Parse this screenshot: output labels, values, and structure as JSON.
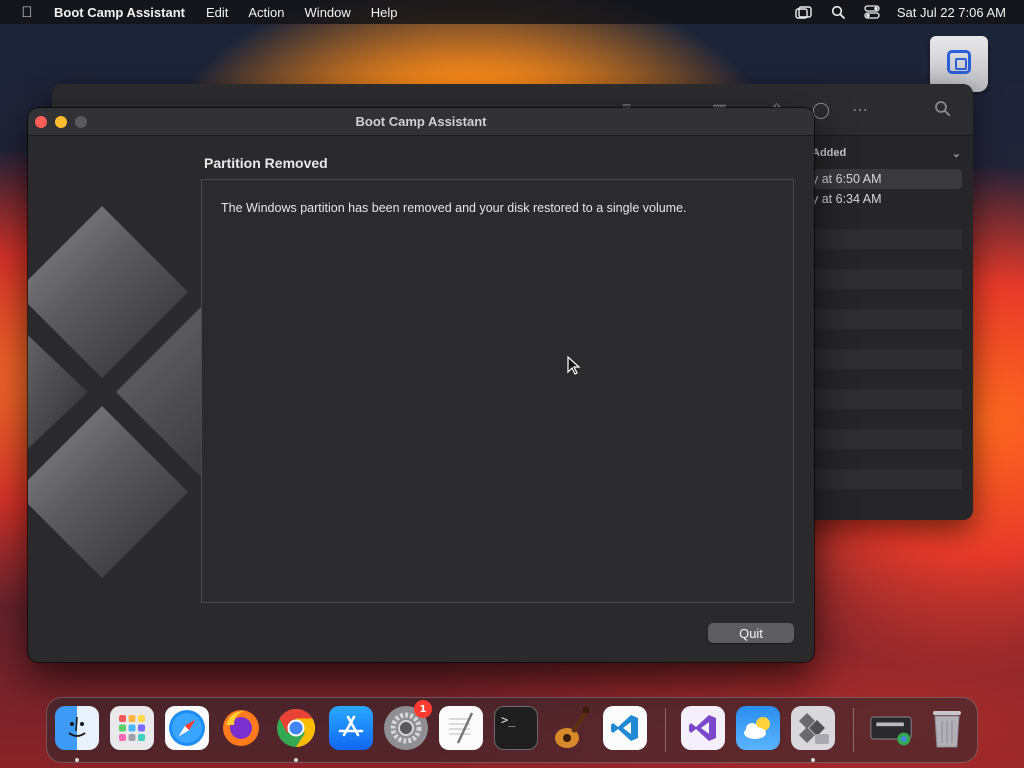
{
  "menubar": {
    "app_name": "Boot Camp Assistant",
    "menus": [
      "Edit",
      "Action",
      "Window",
      "Help"
    ],
    "clock": "Sat Jul 22  7:06 AM"
  },
  "finder": {
    "column_header": "Added",
    "rows": [
      "y at 6:50 AM",
      "y at 6:34 AM"
    ]
  },
  "window": {
    "title": "Boot Camp Assistant",
    "heading": "Partition Removed",
    "message": "The Windows partition has been removed and your disk restored to a single volume.",
    "quit_label": "Quit"
  },
  "dock": {
    "items": [
      {
        "name": "finder-icon",
        "running": true
      },
      {
        "name": "launchpad-icon",
        "running": false
      },
      {
        "name": "safari-icon",
        "running": false
      },
      {
        "name": "firefox-icon",
        "running": false
      },
      {
        "name": "chrome-icon",
        "running": true
      },
      {
        "name": "app-store-icon",
        "running": false
      },
      {
        "name": "system-settings-icon",
        "running": false,
        "badge": "1"
      },
      {
        "name": "textedit-icon",
        "running": false
      },
      {
        "name": "terminal-icon",
        "running": false
      },
      {
        "name": "garageband-icon",
        "running": false
      },
      {
        "name": "vscode-icon",
        "running": false
      },
      {
        "name": "visual-studio-icon",
        "running": false
      },
      {
        "name": "weather-icon",
        "running": false
      },
      {
        "name": "boot-camp-assistant-icon",
        "running": true
      },
      {
        "name": "downloads-stack-icon",
        "running": false
      },
      {
        "name": "trash-icon",
        "running": false
      }
    ]
  }
}
